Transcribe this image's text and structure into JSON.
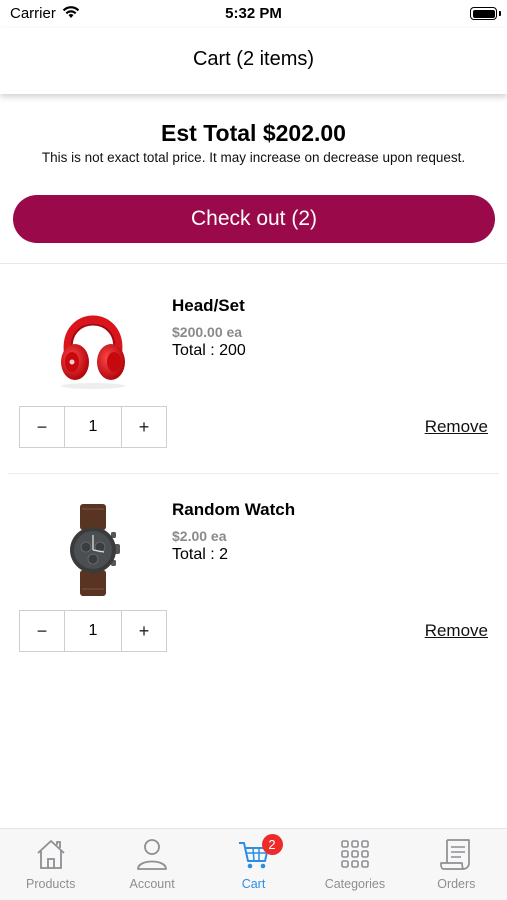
{
  "status_bar": {
    "carrier": "Carrier",
    "time": "5:32 PM"
  },
  "header": {
    "title": "Cart (2 items)"
  },
  "summary": {
    "est_total": "Est Total $202.00",
    "disclaimer": "This is not exact total price. It may increase on decrease upon request.",
    "checkout_label": "Check out (2)"
  },
  "items": [
    {
      "name": "Head/Set",
      "price": "$200.00 ea",
      "total": "Total : 200",
      "quantity": "1",
      "remove_label": "Remove",
      "image_icon": "red-headphones"
    },
    {
      "name": "Random Watch",
      "price": "$2.00 ea",
      "total": "Total : 2",
      "quantity": "1",
      "remove_label": "Remove",
      "image_icon": "wrist-watch"
    }
  ],
  "stepper": {
    "minus": "−",
    "plus": "+"
  },
  "tab_bar": {
    "tabs": [
      {
        "label": "Products",
        "icon": "home-icon"
      },
      {
        "label": "Account",
        "icon": "user-icon"
      },
      {
        "label": "Cart",
        "icon": "cart-icon",
        "badge": "2",
        "active": true
      },
      {
        "label": "Categories",
        "icon": "grid-icon"
      },
      {
        "label": "Orders",
        "icon": "receipt-icon"
      }
    ]
  },
  "colors": {
    "primary": "#9a0a4b",
    "active_tab": "#2b8ee6",
    "inactive_tab": "#8e8e93",
    "badge": "#ee2b2b"
  }
}
